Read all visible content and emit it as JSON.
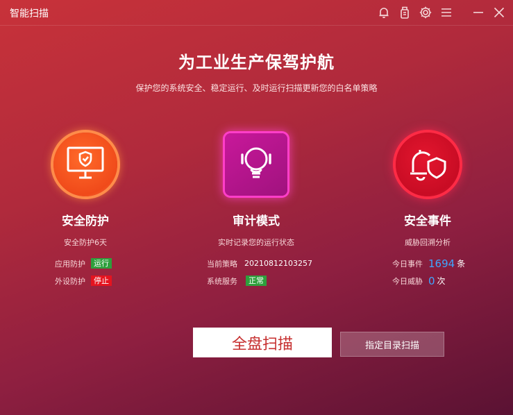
{
  "window": {
    "title": "智能扫描"
  },
  "titlebar_icons": [
    "bell-icon",
    "usb-icon",
    "gear-icon",
    "menu-icon",
    "minimize-icon",
    "close-icon"
  ],
  "header": {
    "headline": "为工业生产保驾护航",
    "subline": "保护您的系统安全、稳定运行、及时运行扫描更新您的白名单策略"
  },
  "cards": [
    {
      "title": "安全防护",
      "subtitle": "安全防护6天",
      "icon": "monitor-shield-icon",
      "color": "#f04a1a"
    },
    {
      "title": "审计模式",
      "subtitle": "实时记录您的运行状态",
      "icon": "lightbulb-icon",
      "color": "#c8189a"
    },
    {
      "title": "安全事件",
      "subtitle": "威胁回溯分析",
      "icon": "bell-shield-icon",
      "color": "#e3162e"
    }
  ],
  "protection": {
    "app_label": "应用防护",
    "app_status": "运行",
    "peripheral_label": "外设防护",
    "peripheral_status": "停止"
  },
  "audit": {
    "policy_label": "当前策略",
    "policy_value": "20210812103257",
    "service_label": "系统服务",
    "service_status": "正常"
  },
  "events": {
    "today_events_label": "今日事件",
    "today_events_count": "1694",
    "today_events_unit": "条",
    "today_threats_label": "今日威胁",
    "today_threats_count": "0",
    "today_threats_unit": "次"
  },
  "actions": {
    "full_scan": "全盘扫描",
    "dir_scan": "指定目录扫描"
  }
}
